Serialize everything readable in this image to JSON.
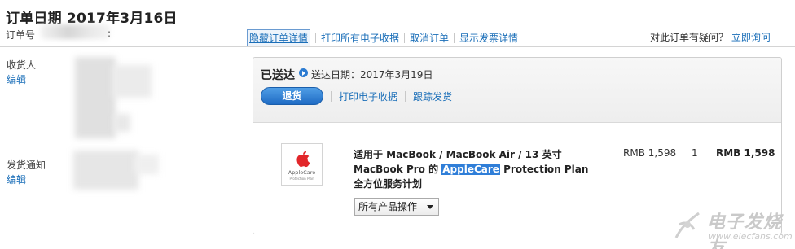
{
  "order": {
    "title": "订单日期 2017年3月16日",
    "number_label": "订单号",
    "number_colon": ":"
  },
  "toolbar": {
    "hide_details": "隐藏订单详情",
    "print_receipts": "打印所有电子收据",
    "cancel_order": "取消订单",
    "show_invoice": "显示发票详情"
  },
  "help": {
    "question": "对此订单有疑问？",
    "contact_now": "立即询问"
  },
  "recipient": {
    "label": "收货人",
    "edit": "编辑"
  },
  "shipping_notice": {
    "label": "发货通知",
    "edit": "编辑"
  },
  "shipment": {
    "status": "已送达",
    "delivery_date": "送达日期：2017年3月19日",
    "return_button": "退货",
    "print_receipt": "打印电子收据",
    "track_shipment": "跟踪发货"
  },
  "item": {
    "image_brand_text": "AppleCare",
    "image_plan_text": "Protection Plan",
    "name_part1": "适用于 MacBook / MacBook Air / 13 英寸 MacBook Pro 的 ",
    "name_highlight": "AppleCare",
    "name_part2": " Protection Plan 全方位服务计划",
    "unit_price": "RMB 1,598",
    "quantity": "1",
    "total_price": "RMB 1,598",
    "actions_select": "所有产品操作"
  },
  "watermark": {
    "name": "电子发烧友",
    "url": "www.elecfans.com"
  },
  "colors": {
    "link": "#1a6eb8",
    "button": "#2b7bd1",
    "highlight": "#2f7ed8"
  }
}
